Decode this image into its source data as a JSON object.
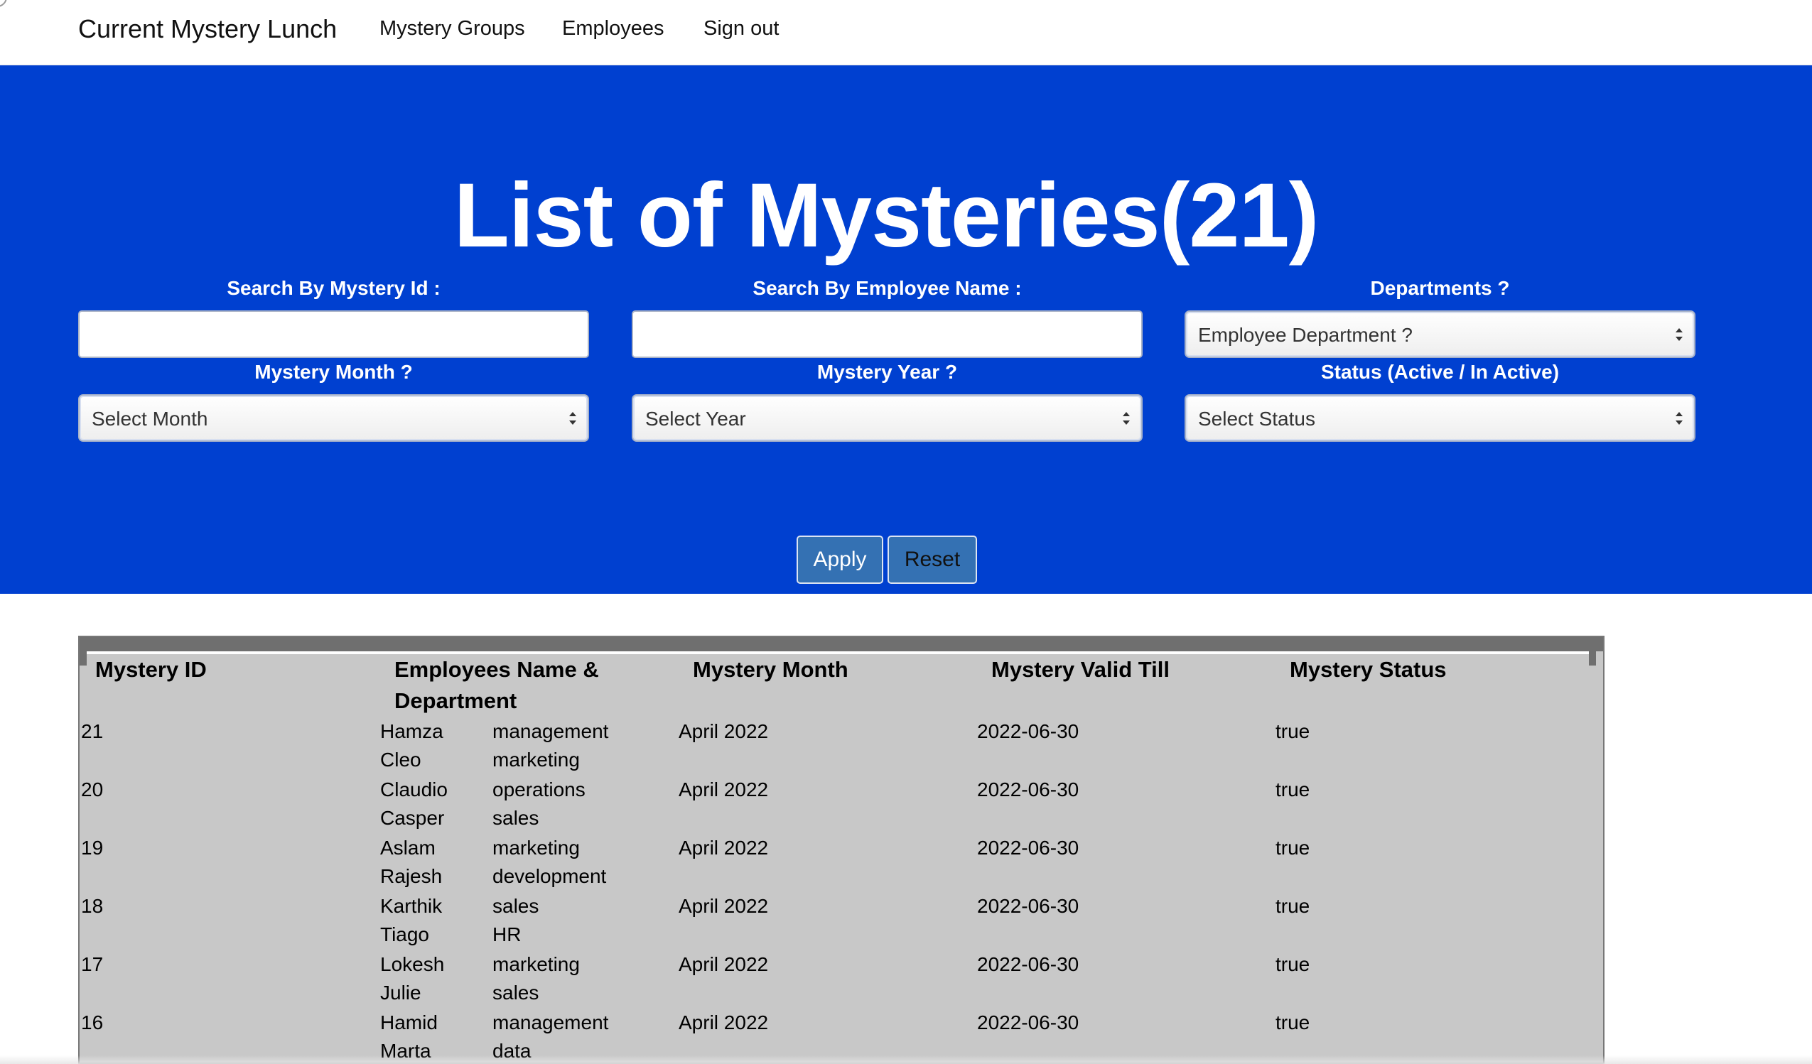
{
  "nav": {
    "brand": "Current Mystery Lunch",
    "links": [
      "Mystery Groups",
      "Employees",
      "Sign out"
    ]
  },
  "hero": {
    "title": "List of Mysteries(21)",
    "filters": {
      "mystery_id_label": "Search By Mystery Id :",
      "employee_name_label": "Search By Employee Name :",
      "departments_label": "Departments ?",
      "department_selected": "Employee Department ?",
      "month_label": "Mystery Month ?",
      "month_selected": "Select Month",
      "year_label": "Mystery Year ?",
      "year_selected": "Select Year",
      "status_label": "Status (Active / In Active)",
      "status_selected": "Select Status",
      "mystery_id_value": "",
      "employee_name_value": ""
    },
    "apply_label": "Apply",
    "reset_label": "Reset"
  },
  "table": {
    "headers": [
      "Mystery ID",
      "Employees Name & Department",
      "Mystery Month",
      "Mystery Valid Till",
      "Mystery Status"
    ],
    "rows": [
      {
        "id": "21",
        "emp1": "Hamza",
        "dept1": "management",
        "emp2": "Cleo",
        "dept2": "marketing",
        "month": "April 2022",
        "valid_till": "2022-06-30",
        "status": "true"
      },
      {
        "id": "20",
        "emp1": "Claudio",
        "dept1": "operations",
        "emp2": "Casper",
        "dept2": "sales",
        "month": "April 2022",
        "valid_till": "2022-06-30",
        "status": "true"
      },
      {
        "id": "19",
        "emp1": "Aslam",
        "dept1": "marketing",
        "emp2": "Rajesh",
        "dept2": "development",
        "month": "April 2022",
        "valid_till": "2022-06-30",
        "status": "true"
      },
      {
        "id": "18",
        "emp1": "Karthik",
        "dept1": "sales",
        "emp2": "Tiago",
        "dept2": "HR",
        "month": "April 2022",
        "valid_till": "2022-06-30",
        "status": "true"
      },
      {
        "id": "17",
        "emp1": "Lokesh",
        "dept1": "marketing",
        "emp2": "Julie",
        "dept2": "sales",
        "month": "April 2022",
        "valid_till": "2022-06-30",
        "status": "true"
      },
      {
        "id": "16",
        "emp1": "Hamid",
        "dept1": "management",
        "emp2": "Marta",
        "dept2": "data",
        "month": "April 2022",
        "valid_till": "2022-06-30",
        "status": "true"
      }
    ]
  },
  "colors": {
    "hero_bg": "#0040d0",
    "button_bg": "#3471b3",
    "table_bg": "#c8c8c8"
  }
}
